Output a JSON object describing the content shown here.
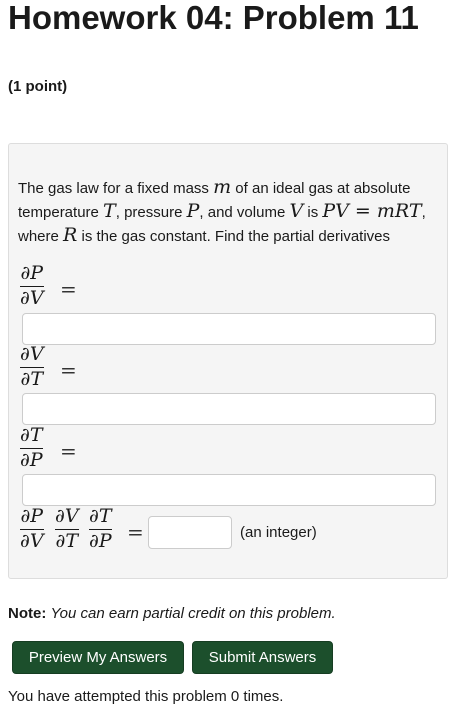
{
  "header": {
    "title": "Homework 04: Problem 11",
    "points": "(1 point)"
  },
  "problem": {
    "intro": "The gas law for a fixed mass",
    "var_m": "m",
    "of_ideal": "of an ideal gas at absolute temperature",
    "var_T": "T",
    "pressure": ", pressure",
    "var_P": "P",
    "and_volume": ", and volume",
    "var_V": "V",
    "is": "is",
    "formula": "PV = mRT",
    "where": ", where",
    "var_R": "R",
    "gas_constant": "is the gas constant. Find the partial derivatives",
    "equals": "=",
    "parts": [
      {
        "numerator": "∂P",
        "denominator": "∂V",
        "answer_value": ""
      },
      {
        "numerator": "∂V",
        "denominator": "∂T",
        "answer_value": ""
      },
      {
        "numerator": "∂T",
        "denominator": "∂P",
        "answer_value": ""
      }
    ],
    "product": {
      "fractions": [
        {
          "numerator": "∂P",
          "denominator": "∂V"
        },
        {
          "numerator": "∂V",
          "denominator": "∂T"
        },
        {
          "numerator": "∂T",
          "denominator": "∂P"
        }
      ],
      "answer_value": "",
      "hint": "(an integer)"
    }
  },
  "note": {
    "label": "Note:",
    "text": "You can earn partial credit on this problem."
  },
  "buttons": {
    "preview": "Preview My Answers",
    "submit": "Submit Answers"
  },
  "footer": {
    "attempts": "You have attempted this problem 0 times."
  }
}
